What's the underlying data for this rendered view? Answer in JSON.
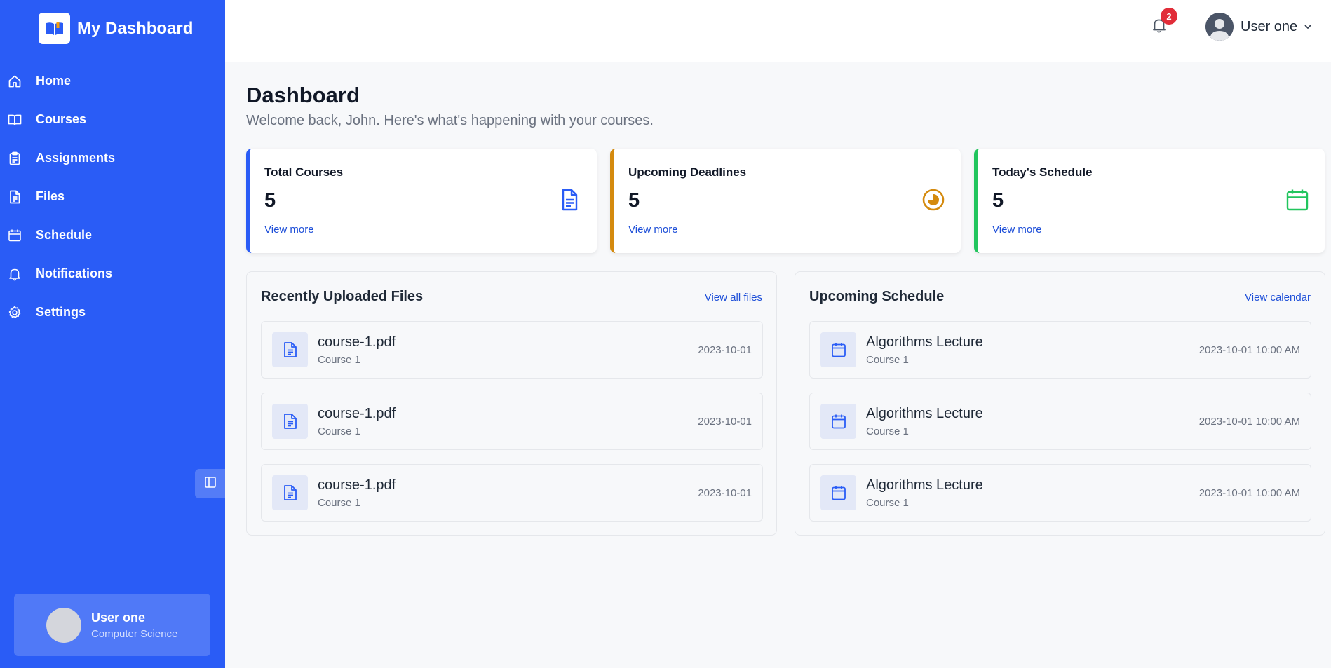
{
  "app": {
    "title": "My Dashboard"
  },
  "sidebar": {
    "items": [
      {
        "label": "Home",
        "icon": "home-icon"
      },
      {
        "label": "Courses",
        "icon": "book-icon"
      },
      {
        "label": "Assignments",
        "icon": "clipboard-icon"
      },
      {
        "label": "Files",
        "icon": "file-icon"
      },
      {
        "label": "Schedule",
        "icon": "calendar-icon"
      },
      {
        "label": "Notifications",
        "icon": "bell-icon"
      },
      {
        "label": "Settings",
        "icon": "gear-icon"
      }
    ],
    "user": {
      "name": "User one",
      "department": "Computer Science"
    }
  },
  "header": {
    "notification_count": "2",
    "user_name": "User one"
  },
  "page": {
    "title": "Dashboard",
    "subtitle": "Welcome back, John. Here's what's happening with your courses."
  },
  "stats": [
    {
      "label": "Total Courses",
      "value": "5",
      "link": "View more",
      "icon": "document-icon",
      "color": "#2a5cf6"
    },
    {
      "label": "Upcoming Deadlines",
      "value": "5",
      "link": "View more",
      "icon": "pie-clock-icon",
      "color": "#d48a0e"
    },
    {
      "label": "Today's Schedule",
      "value": "5",
      "link": "View more",
      "icon": "calendar-icon",
      "color": "#22c55e"
    }
  ],
  "files_panel": {
    "title": "Recently Uploaded Files",
    "link": "View all files",
    "rows": [
      {
        "title": "course-1.pdf",
        "sub": "Course 1",
        "meta": "2023-10-01"
      },
      {
        "title": "course-1.pdf",
        "sub": "Course 1",
        "meta": "2023-10-01"
      },
      {
        "title": "course-1.pdf",
        "sub": "Course 1",
        "meta": "2023-10-01"
      }
    ]
  },
  "schedule_panel": {
    "title": "Upcoming Schedule",
    "link": "View calendar",
    "rows": [
      {
        "title": "Algorithms Lecture",
        "sub": "Course 1",
        "meta": "2023-10-01 10:00 AM"
      },
      {
        "title": "Algorithms Lecture",
        "sub": "Course 1",
        "meta": "2023-10-01 10:00 AM"
      },
      {
        "title": "Algorithms Lecture",
        "sub": "Course 1",
        "meta": "2023-10-01 10:00 AM"
      }
    ]
  }
}
